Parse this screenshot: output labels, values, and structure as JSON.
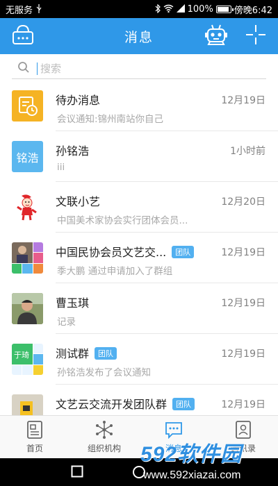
{
  "status_bar": {
    "carrier": "无服务",
    "battery": "100%",
    "battery_level": 1.0,
    "time": "傍晚6:42"
  },
  "header": {
    "title": "消息"
  },
  "search": {
    "placeholder": "搜索",
    "value": ""
  },
  "conversations": [
    {
      "name": "待办消息",
      "subtitle": "会议通知:锦州南站你自己",
      "time": "12月19日",
      "badge": "",
      "avatar_text": ""
    },
    {
      "name": "孙铭浩",
      "subtitle": "iii",
      "time": "1小时前",
      "badge": "",
      "avatar_text": "铭浩"
    },
    {
      "name": "文联小艺",
      "subtitle": "中国美术家协会实行团体会员...",
      "time": "12月20日",
      "badge": "",
      "avatar_text": ""
    },
    {
      "name": "中国民协会员文艺交...",
      "subtitle": "季大鹏 通过申请加入了群组",
      "time": "12月19日",
      "badge": "团队",
      "avatar_text": ""
    },
    {
      "name": "曹玉琪",
      "subtitle": "记录",
      "time": "12月19日",
      "badge": "",
      "avatar_text": ""
    },
    {
      "name": "测试群",
      "subtitle": "孙铭浩发布了会议通知",
      "time": "12月19日",
      "badge": "团队",
      "avatar_text": "于琦"
    },
    {
      "name": "文艺云交流开发团队群",
      "subtitle": "",
      "time": "12月19日",
      "badge": "团队",
      "avatar_text": ""
    }
  ],
  "tabs": [
    {
      "label": "首页",
      "icon": "document-icon",
      "active": false
    },
    {
      "label": "组织机构",
      "icon": "network-icon",
      "active": false
    },
    {
      "label": "消息",
      "icon": "chat-icon",
      "active": true
    },
    {
      "label": "通讯录",
      "icon": "contacts-icon",
      "active": false
    }
  ],
  "watermark": {
    "brand": "592软件园",
    "url": "www.592xiazai.com"
  },
  "colors": {
    "accent": "#2f98e8",
    "badge": "#52b0f0",
    "todo": "#f5b324",
    "avatar_blue": "#5bb7ef",
    "group_green": "#3cbf6a"
  }
}
